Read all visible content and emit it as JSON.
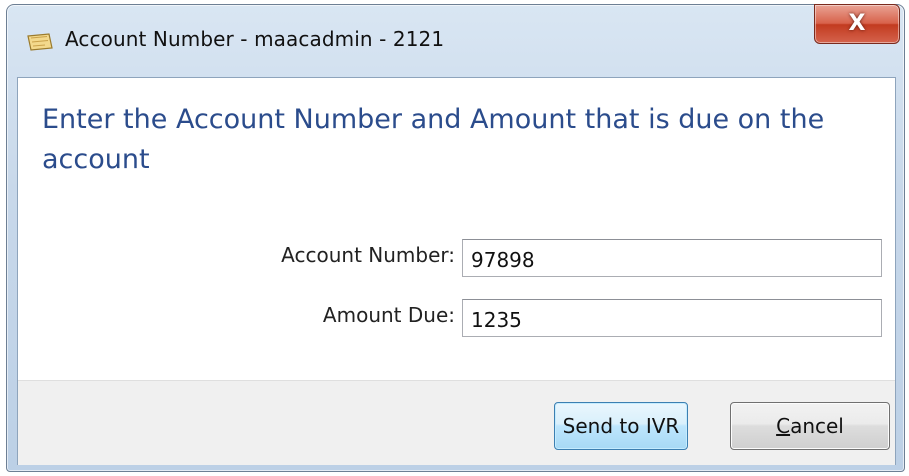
{
  "window": {
    "title": "Account Number - maacadmin - 2121",
    "close_symbol": "X",
    "icon": "ticket-icon"
  },
  "dialog": {
    "heading": "Enter the Account Number and Amount that is due on the account",
    "fields": [
      {
        "label": "Account Number:",
        "value": "97898",
        "placeholder": ""
      },
      {
        "label": "Amount Due:",
        "value": "1235",
        "placeholder": ""
      }
    ]
  },
  "buttons": {
    "send": "Send to IVR",
    "cancel_accel": "C",
    "cancel_rest": "ancel"
  },
  "colors": {
    "heading": "#2b4c8c",
    "close_button": "#c23b20",
    "primary_border": "#3c7fb1"
  }
}
